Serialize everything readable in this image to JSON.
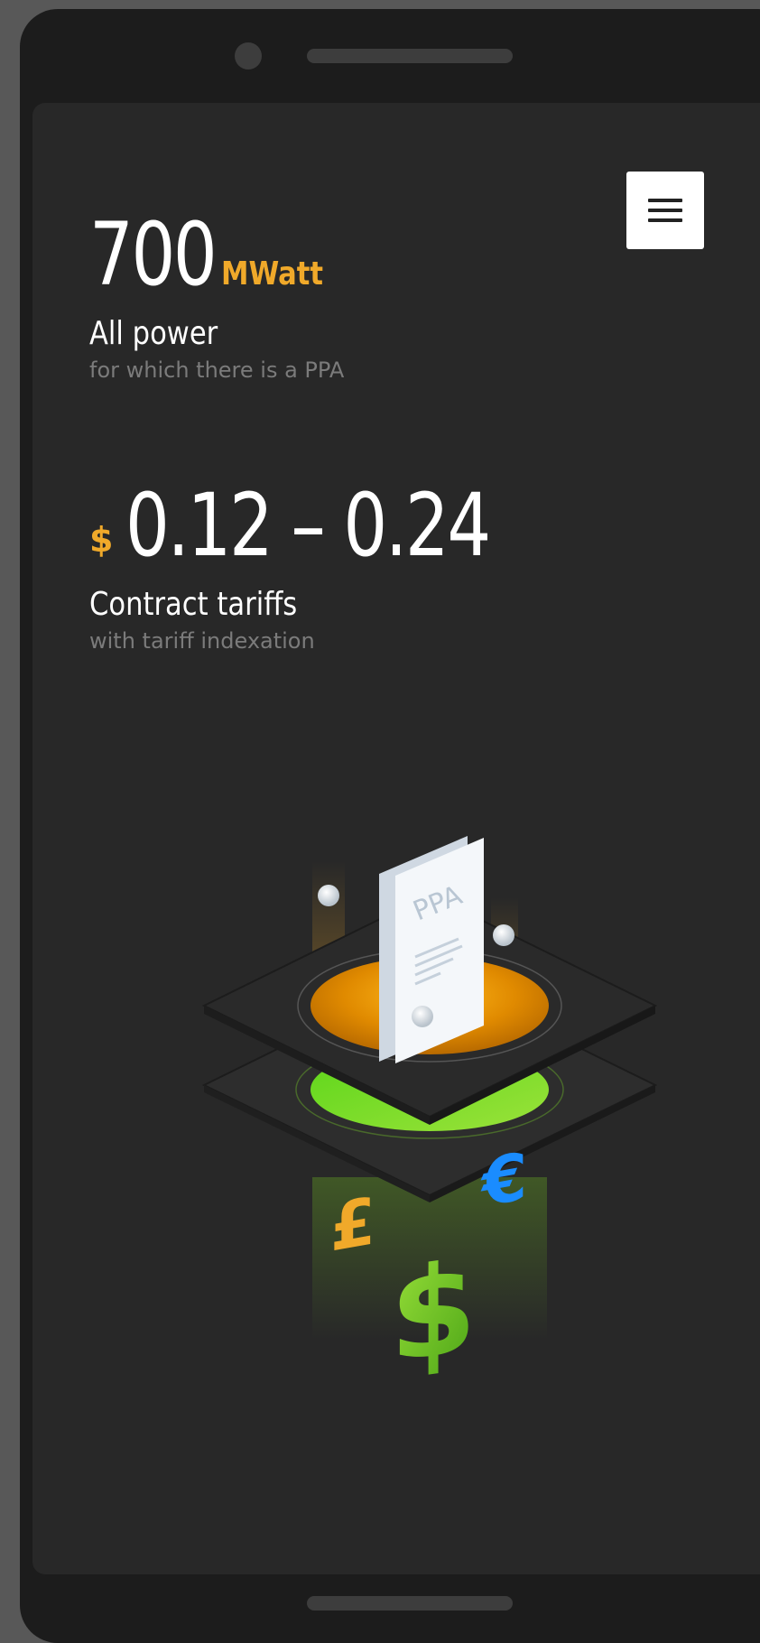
{
  "stats": [
    {
      "value": "700",
      "unit": "MWatt",
      "label": "All power",
      "sublabel": "for which there is a PPA"
    },
    {
      "currency": "$",
      "value": "0.12 – 0.24",
      "label": "Contract tariffs",
      "sublabel": "with tariff indexation"
    }
  ],
  "illustration": {
    "document_label": "PPA",
    "currency_symbols": [
      "£",
      "$",
      "€"
    ]
  },
  "colors": {
    "accent": "#f0a92a",
    "background": "#282828",
    "green": "#7ed321",
    "blue": "#1a8cff"
  },
  "icons": {
    "menu": "hamburger-menu-icon"
  }
}
